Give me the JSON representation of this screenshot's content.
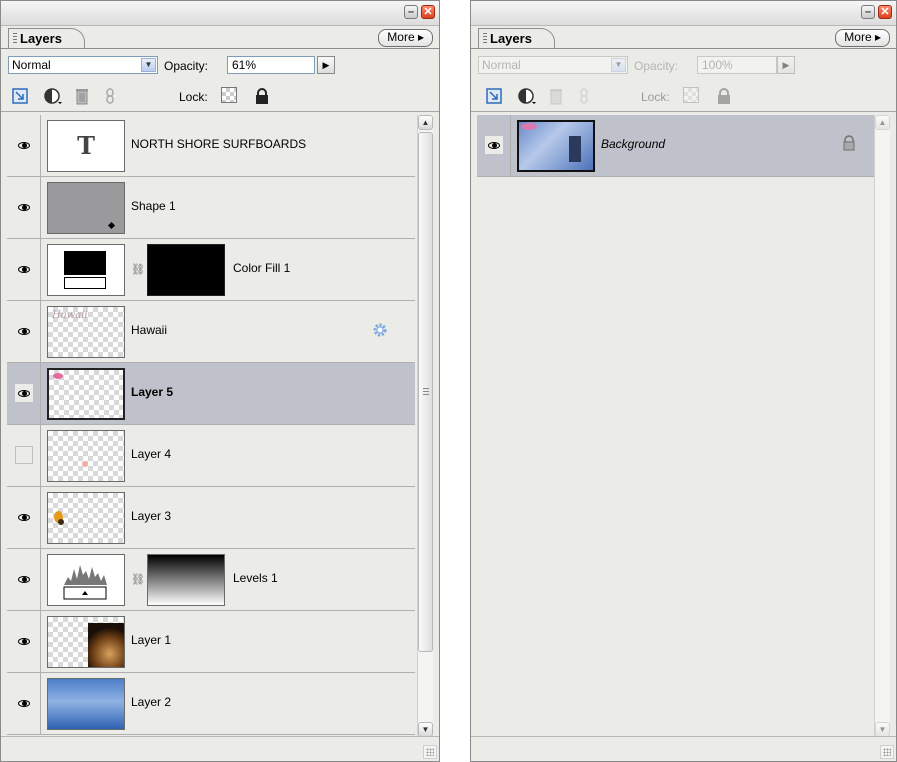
{
  "left_panel": {
    "tab_label": "Layers",
    "more_label": "More",
    "more_arrow": "▸",
    "blend_mode": "Normal",
    "opacity_label": "Opacity:",
    "opacity_value": "61%",
    "lock_label": "Lock:",
    "layers": [
      {
        "name": "NORTH SHORE SURFBOARDS",
        "visible": true,
        "type": "text",
        "thumb_icon": "T"
      },
      {
        "name": "Shape 1",
        "visible": true,
        "type": "shape"
      },
      {
        "name": "Color Fill 1",
        "visible": true,
        "type": "fill-adjustment",
        "linked": true
      },
      {
        "name": "Hawaii",
        "visible": true,
        "type": "pixel",
        "thumb_text": "Hawaii",
        "badge_icon": "gear-icon"
      },
      {
        "name": "Layer 5",
        "visible": true,
        "type": "pixel",
        "selected": true
      },
      {
        "name": "Layer 4",
        "visible": false,
        "type": "pixel"
      },
      {
        "name": "Layer 3",
        "visible": true,
        "type": "pixel"
      },
      {
        "name": "Levels 1",
        "visible": true,
        "type": "levels-adjustment",
        "linked": true
      },
      {
        "name": "Layer 1",
        "visible": true,
        "type": "pixel"
      },
      {
        "name": "Layer 2",
        "visible": true,
        "type": "pixel"
      }
    ]
  },
  "right_panel": {
    "tab_label": "Layers",
    "more_label": "More",
    "more_arrow": "▸",
    "blend_mode": "Normal",
    "opacity_label": "Opacity:",
    "opacity_value": "100%",
    "lock_label": "Lock:",
    "layers": [
      {
        "name": "Background",
        "visible": true,
        "type": "background",
        "locked": true
      }
    ]
  },
  "colors": {
    "panel_bg": "#ebebe7",
    "selected_row": "#c0c2cb",
    "close_button": "#e0532f"
  }
}
